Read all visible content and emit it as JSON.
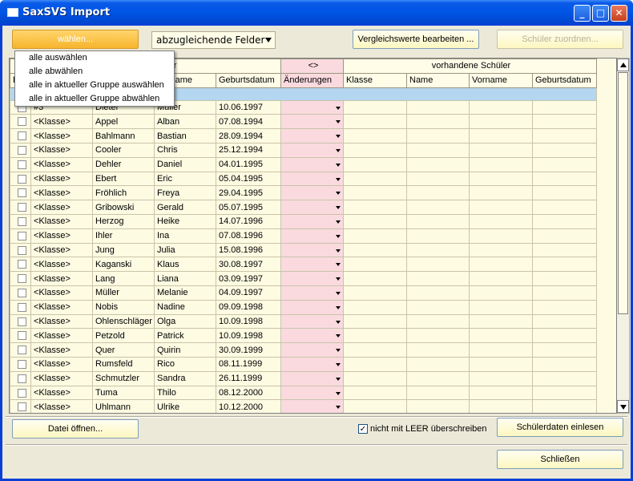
{
  "window": {
    "title": "SaxSVS Import"
  },
  "toolbar": {
    "select_button": "wählen...",
    "fields_combo": "abzugleichende Felder",
    "edit_compare_button": "Vergleichswerte bearbeiten ...",
    "assign_button": "Schüler zuordnen..."
  },
  "menu": {
    "items": [
      "alle auswählen",
      "alle abwählen",
      "alle in aktueller Gruppe auswählen",
      "alle in aktueller Gruppe abwählen"
    ]
  },
  "grid": {
    "group_headers": {
      "new_students": "hüler",
      "compare": "<>",
      "existing_students": "vorhandene Schüler"
    },
    "columns": {
      "first": "E",
      "vorname": "Vorname",
      "geburtsdatum": "Geburtsdatum",
      "aenderungen": "Änderungen",
      "klasse": "Klasse",
      "name": "Name",
      "vorname2": "Vorname",
      "geburtsdatum2": "Geburtsdatum"
    },
    "rows": [
      {
        "klasse": "#3",
        "name": "Dieter",
        "vorname": "Müller",
        "geb": "10.06.1997"
      },
      {
        "klasse": "<Klasse>",
        "name": "Appel",
        "vorname": "Alban",
        "geb": "07.08.1994"
      },
      {
        "klasse": "<Klasse>",
        "name": "Bahlmann",
        "vorname": "Bastian",
        "geb": "28.09.1994"
      },
      {
        "klasse": "<Klasse>",
        "name": "Cooler",
        "vorname": "Chris",
        "geb": "25.12.1994"
      },
      {
        "klasse": "<Klasse>",
        "name": "Dehler",
        "vorname": "Daniel",
        "geb": "04.01.1995"
      },
      {
        "klasse": "<Klasse>",
        "name": "Ebert",
        "vorname": "Eric",
        "geb": "05.04.1995"
      },
      {
        "klasse": "<Klasse>",
        "name": "Fröhlich",
        "vorname": "Freya",
        "geb": "29.04.1995"
      },
      {
        "klasse": "<Klasse>",
        "name": "Gribowski",
        "vorname": "Gerald",
        "geb": "05.07.1995"
      },
      {
        "klasse": "<Klasse>",
        "name": "Herzog",
        "vorname": "Heike",
        "geb": "14.07.1996"
      },
      {
        "klasse": "<Klasse>",
        "name": "Ihler",
        "vorname": "Ina",
        "geb": "07.08.1996"
      },
      {
        "klasse": "<Klasse>",
        "name": "Jung",
        "vorname": "Julia",
        "geb": "15.08.1996"
      },
      {
        "klasse": "<Klasse>",
        "name": "Kaganski",
        "vorname": "Klaus",
        "geb": "30.08.1997"
      },
      {
        "klasse": "<Klasse>",
        "name": "Lang",
        "vorname": "Liana",
        "geb": "03.09.1997"
      },
      {
        "klasse": "<Klasse>",
        "name": "Müller",
        "vorname": "Melanie",
        "geb": "04.09.1997"
      },
      {
        "klasse": "<Klasse>",
        "name": "Nobis",
        "vorname": "Nadine",
        "geb": "09.09.1998"
      },
      {
        "klasse": "<Klasse>",
        "name": "Ohlenschläger",
        "vorname": "Olga",
        "geb": "10.09.1998"
      },
      {
        "klasse": "<Klasse>",
        "name": "Petzold",
        "vorname": "Patrick",
        "geb": "10.09.1998"
      },
      {
        "klasse": "<Klasse>",
        "name": "Quer",
        "vorname": "Quirin",
        "geb": "30.09.1999"
      },
      {
        "klasse": "<Klasse>",
        "name": "Rumsfeld",
        "vorname": "Rico",
        "geb": "08.11.1999"
      },
      {
        "klasse": "<Klasse>",
        "name": "Schmutzler",
        "vorname": "Sandra",
        "geb": "26.11.1999"
      },
      {
        "klasse": "<Klasse>",
        "name": "Tuma",
        "vorname": "Thilo",
        "geb": "08.12.2000"
      },
      {
        "klasse": "<Klasse>",
        "name": "Uhlmann",
        "vorname": "Ulrike",
        "geb": "10.12.2000"
      }
    ]
  },
  "footer": {
    "open_file_button": "Datei öffnen...",
    "no_overwrite_label": "nicht mit LEER überschreiben",
    "no_overwrite_checked": "✓",
    "read_button": "Schülerdaten einlesen",
    "close_button": "Schließen"
  },
  "colors": {
    "accent_orange": "#f7b52e",
    "compare_pink": "#fadadf",
    "selection_blue": "#b4d6f0",
    "titlebar_blue": "#0055e5"
  }
}
